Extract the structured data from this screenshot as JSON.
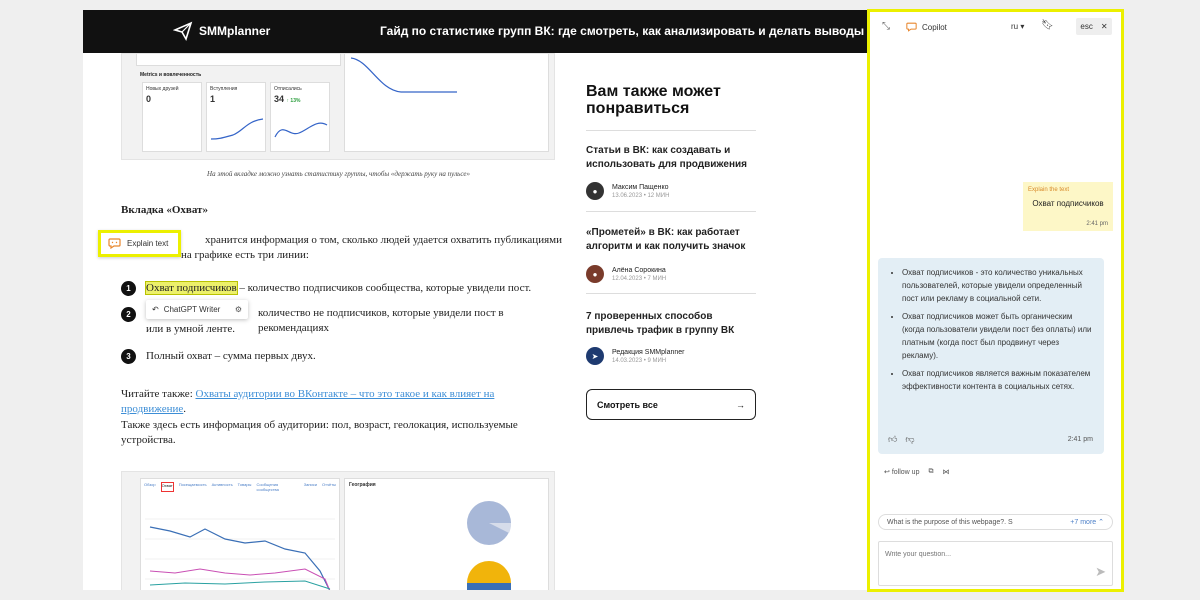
{
  "header": {
    "logo_text": "SMMplanner",
    "title": "Гайд по статистике групп ВК: где смотреть, как анализировать и делать выводы"
  },
  "article": {
    "screenshot_cards": {
      "section_title": "Metrics и вовлеченность",
      "stats": [
        {
          "label": "Новых друзей",
          "value": "0"
        },
        {
          "label": "Вступления",
          "value": "1"
        },
        {
          "label": "Отписались",
          "value": "34",
          "delta": "↑ 13%"
        }
      ]
    },
    "caption": "На этой вкладке можно узнать статистику группы, чтобы «держать руку на пульсе»",
    "section_heading": "Вкладка «Охват»",
    "intro": "хранится информация о том, сколько людей удается охватить публикациями",
    "intro_line2": "на графике есть три линии:",
    "items": [
      {
        "num": "1",
        "highlight": "Охват подписчиков",
        "rest": " – количество подписчиков сообщества, которые увидели пост."
      },
      {
        "num": "2",
        "text": "количество не подписчиков, которые увидели пост в рекомендациях",
        "text_line2": "или в умной ленте."
      },
      {
        "num": "3",
        "text": "Полный охват – сумма первых двух."
      }
    ],
    "read_also_prefix": "Читайте также: ",
    "read_also_link": "Охваты аудитории во ВКонтакте – что это такое и как влияет на продвижение",
    "read_also_suffix": ".",
    "audience_text": "Также здесь есть информация об аудитории: пол, возраст, геолокация, используемые",
    "audience_text_line2": "устройства.",
    "bottom_tabs": [
      "Обзор",
      "Охват",
      "Посещаемость",
      "Активность",
      "Товары",
      "Сообщения сообщества",
      "Записи",
      "Отчёты"
    ],
    "bottom_geo_title": "География"
  },
  "popups": {
    "explain_text": "Explain text",
    "gpt_writer": "ChatGPT Writer"
  },
  "recommendations": {
    "title": "Вам также может понравиться",
    "items": [
      {
        "title": "Статьи в ВК: как создавать и использовать для продвижения",
        "author": "Максим Пащенко",
        "date": "13.06.2023",
        "read": "12 МИН"
      },
      {
        "title": "«Прометей» в ВК: как работает алгоритм и как получить значок",
        "author": "Алёна Сорокина",
        "date": "12.04.2023",
        "read": "7 МИН"
      },
      {
        "title": "7 проверенных способов привлечь трафик в группу ВК",
        "author": "Редакция SMMplanner",
        "date": "14.03.2023",
        "read": "9 МИН"
      }
    ],
    "see_all": "Смотреть все"
  },
  "copilot": {
    "name": "Copilot",
    "lang": "ru",
    "esc": "esc",
    "user_message": {
      "label": "Explain the text",
      "text": "Охват подписчиков",
      "time": "2:41 pm"
    },
    "bot_message": {
      "bullets": [
        "Охват подписчиков - это количество уникальных пользователей, которые увидели определенный пост или рекламу в социальной сети.",
        "Охват подписчиков может быть органическим (когда пользователи увидели пост без оплаты) или платным (когда пост был продвинут через рекламу).",
        "Охват подписчиков является важным показателем эффективности контента в социальных сетях."
      ],
      "time": "2:41 pm"
    },
    "follow_up": "follow up",
    "suggestion": "What is the purpose of this webpage?. S",
    "more": "+7 more",
    "composer_placeholder": "Write your question..."
  },
  "colors": {
    "highlight": "#ecf000",
    "link": "#3d8ed6",
    "header_bg": "#111111"
  }
}
